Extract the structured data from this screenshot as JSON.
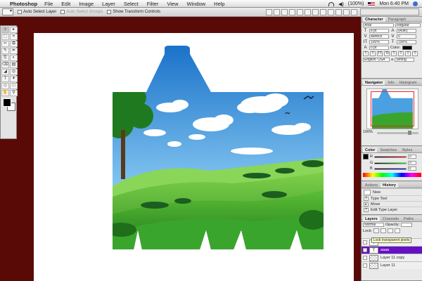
{
  "menubar": {
    "app_name": "Photoshop",
    "items": [
      "File",
      "Edit",
      "Image",
      "Layer",
      "Select",
      "Filter",
      "View",
      "Window",
      "Help"
    ],
    "battery": "(100%)",
    "clock": "Mon 6:40 PM"
  },
  "options_bar": {
    "auto_select_layer": "Auto Select Layer",
    "auto_select_groups": "Auto Select Groups",
    "show_transform_controls": "Show Transform Controls"
  },
  "toolbox": {
    "tools": [
      "⊹",
      "▸",
      "⬚",
      "⌖",
      "✂",
      "⧉",
      "✎",
      "✒",
      "⎘",
      "◐",
      "⌫",
      "▤",
      "◢",
      "◎",
      "T",
      "✦",
      "◇",
      "□",
      "✋",
      "⚲"
    ]
  },
  "character_panel": {
    "tabs": [
      "Character",
      "Paragraph"
    ],
    "font_family": "Arial",
    "font_style": "Regular",
    "size": "8 pt",
    "leading": "(Auto)",
    "tracking": "0",
    "kerning": "Metrics",
    "vertical_scale": "100%",
    "horizontal_scale": "100%",
    "baseline": "0 pt",
    "color_label": "Color:",
    "style_buttons": [
      "T",
      "T",
      "TT",
      "Tt",
      "T",
      "T",
      "T",
      "T"
    ],
    "language": "English: USA",
    "antialias_label": "a",
    "antialias": "Strong"
  },
  "navigator_panel": {
    "tabs": [
      "Navigator",
      "Info",
      "Histogram"
    ],
    "zoom": "100%"
  },
  "color_panel": {
    "tabs": [
      "Color",
      "Swatches",
      "Styles"
    ],
    "channels": [
      {
        "label": "R",
        "value": "0"
      },
      {
        "label": "G",
        "value": "0"
      },
      {
        "label": "B",
        "value": "0"
      }
    ]
  },
  "history_panel": {
    "tabs": [
      "Actions",
      "History"
    ],
    "snapshot": "New",
    "items": [
      {
        "icon": "T",
        "label": "Type Tool"
      },
      {
        "icon": "▸",
        "label": "Move"
      },
      {
        "icon": "T",
        "label": "Edit Type Layer"
      }
    ]
  },
  "layers_panel": {
    "tabs": [
      "Layers",
      "Channels",
      "Paths"
    ],
    "blend_mode": "Normal",
    "opacity_label": "Opacity:",
    "lock_label": "Lock:",
    "tooltip": "Lock transparent pixels",
    "layers": [
      {
        "name": "",
        "type": "type",
        "selected": false
      },
      {
        "name": "aaaa",
        "type": "type",
        "selected": true
      },
      {
        "name": "Layer 11 copy",
        "type": "raster",
        "selected": false
      },
      {
        "name": "Layer 11",
        "type": "raster",
        "selected": false
      }
    ]
  },
  "colors": {
    "canvas_background": "#5a0a06",
    "selection": "#6611c2",
    "sky_top": "#1a72c9",
    "grass": "#3aa52c"
  }
}
